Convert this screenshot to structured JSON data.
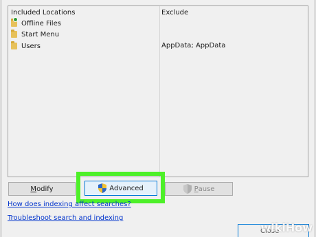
{
  "table": {
    "included_header": "Included Locations",
    "exclude_header": "Exclude",
    "rows": [
      {
        "label": "Offline Files",
        "icon": "offline-folder-icon",
        "exclude": ""
      },
      {
        "label": "Start Menu",
        "icon": "folder-icon",
        "exclude": ""
      },
      {
        "label": "Users",
        "icon": "folder-icon",
        "exclude": "AppData; AppData"
      }
    ]
  },
  "buttons": {
    "modify_accel": "M",
    "modify_rest": "odify",
    "advanced_accel": "A",
    "advanced_rest": "dvanced",
    "pause_accel": "P",
    "pause_rest": "ause"
  },
  "links": {
    "help_indexing": "How does indexing affect searches?",
    "troubleshoot": "Troubleshoot search and indexing"
  },
  "footer": {
    "close_label": "Close"
  },
  "watermark": "wikiHow",
  "colors": {
    "highlight": "#4df028",
    "link": "#0033cc",
    "focus_border": "#0078d7"
  }
}
